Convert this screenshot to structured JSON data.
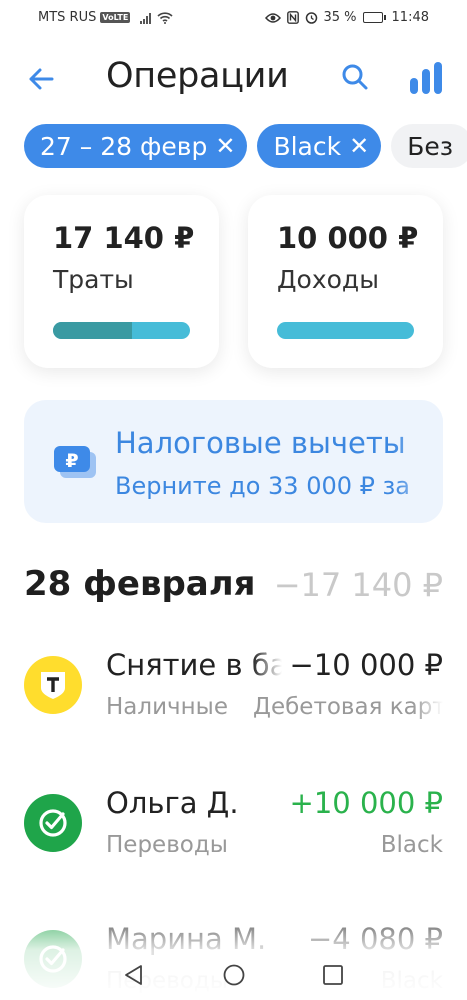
{
  "status_bar": {
    "carrier": "MTS RUS",
    "volte": "VoLTE",
    "battery": "35 %",
    "battery_level": 0.35,
    "time": "11:48"
  },
  "header": {
    "title": "Операции",
    "back_icon": "arrow-left-icon",
    "search_icon": "search-icon",
    "stats_icon": "bar-chart-icon"
  },
  "filters": [
    {
      "label": "27 – 28 февр",
      "active": true
    },
    {
      "label": "Black",
      "active": true
    },
    {
      "label": "Без",
      "active": false
    }
  ],
  "summary": {
    "spend": {
      "amount": "17 140 ₽",
      "label": "Траты",
      "bar_fraction": 0.58
    },
    "income": {
      "amount": "10 000 ₽",
      "label": "Доходы"
    }
  },
  "promo": {
    "title": "Налоговые вычеты",
    "subtitle": "Верните до 33 000 ₽ за",
    "icon": "ruble-card-icon"
  },
  "day": {
    "date": "28 февраля",
    "total": "−17 140 ₽"
  },
  "transactions": [
    {
      "name": "Снятие в банкомате",
      "amount": "−10 000 ₽",
      "category": "Наличные",
      "account": "Дебетовая карта",
      "icon": "tbank-logo-icon",
      "color": "#ffdd2d",
      "positive": false
    },
    {
      "name": "Ольга Д.",
      "amount": "+10 000 ₽",
      "category": "Переводы",
      "account": "Black",
      "icon": "transfer-check-icon",
      "color": "#1fa54a",
      "positive": true
    },
    {
      "name": "Марина М.",
      "amount": "−4 080 ₽",
      "category": "Переводы",
      "account": "Black",
      "icon": "transfer-check-icon",
      "color": "#1fa54a",
      "positive": false
    }
  ],
  "colors": {
    "accent": "#3e8ae8",
    "positive": "#2ab24c",
    "bar_dark": "#3a9aa2",
    "bar_light": "#46bcd8"
  }
}
